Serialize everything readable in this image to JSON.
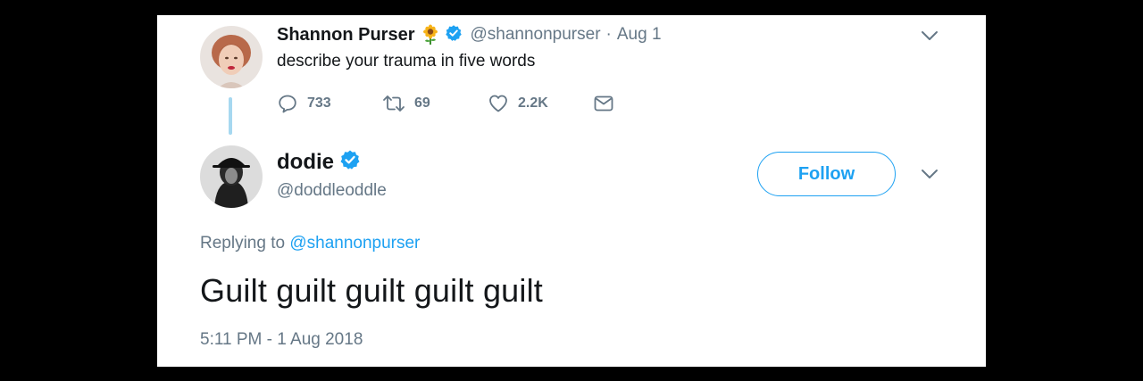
{
  "parent_tweet": {
    "author_name": "Shannon Purser",
    "name_emoji": "sunflower-icon",
    "handle": "@shannonpurser",
    "separator": "·",
    "date": "Aug 1",
    "text": "describe your trauma in five words",
    "reply_count": "733",
    "retweet_count": "69",
    "like_count": "2.2K"
  },
  "reply_tweet": {
    "author_name": "dodie",
    "handle": "@doddleoddle",
    "follow_label": "Follow",
    "replying_prefix": "Replying to",
    "replying_to": "@shannonpurser",
    "text": "Guilt guilt guilt guilt guilt",
    "timestamp": "5:11 PM - 1 Aug 2018"
  },
  "colors": {
    "accent": "#1da1f2",
    "secondary_text": "#657786",
    "primary_text": "#14171a",
    "thread_line": "#a6d8f0"
  }
}
